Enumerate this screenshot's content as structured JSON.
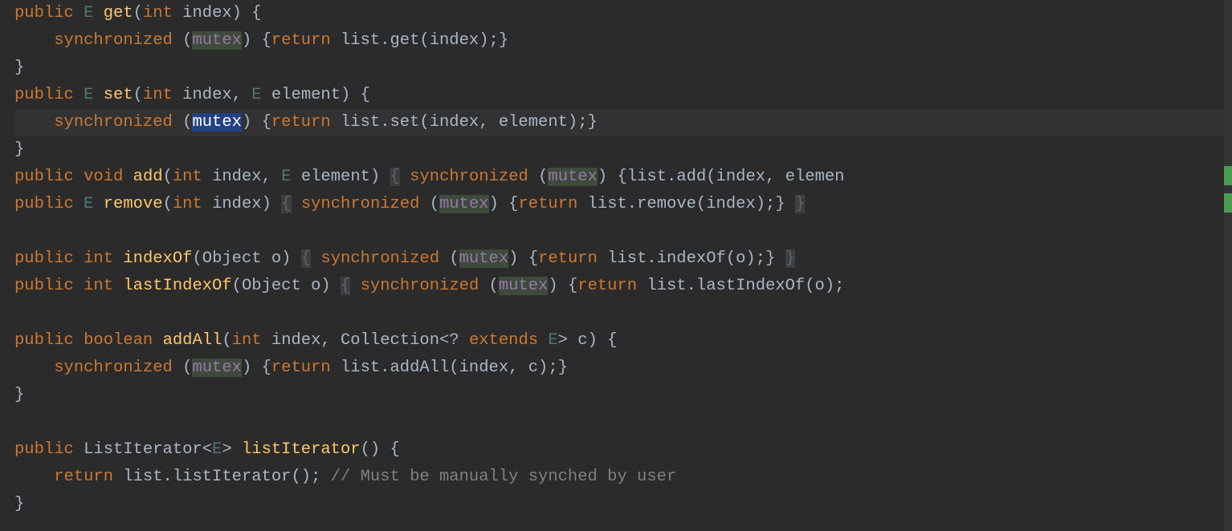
{
  "code": {
    "l1": {
      "kw1": "public",
      "type": "E",
      "method": "get",
      "sig1": "(",
      "kw2": "int",
      "sig2": " index) {"
    },
    "l2": {
      "kw": "synchronized",
      "p1": " (",
      "mut": "mutex",
      "p2": ") {",
      "ret": "return",
      "rest": " list.get(index);}"
    },
    "l3": {
      "br": "}"
    },
    "l4": {
      "kw1": "public",
      "type": "E",
      "method": "set",
      "sig1": "(",
      "kw2": "int",
      "sig2": " index, ",
      "type2": "E",
      "sig3": " element) {"
    },
    "l5": {
      "kw": "synchronized",
      "p1": " (",
      "mut": "mutex",
      "p2": ") {",
      "ret": "return",
      "rest": " list.set(index, element);}"
    },
    "l6": {
      "br": "}"
    },
    "l7": {
      "kw1": "public",
      "kw2": "void",
      "method": "add",
      "sig1": "(",
      "kw3": "int",
      "sig2": " index, ",
      "type": "E",
      "sig3": " element) ",
      "bh1": "{",
      "sp": " ",
      "kw4": "synchronized",
      "p1": " (",
      "mut": "mutex",
      "p2": ") {list.add(index, elemen"
    },
    "l8": {
      "kw1": "public",
      "type": "E",
      "method": "remove",
      "sig1": "(",
      "kw2": "int",
      "sig2": " index) ",
      "bh1": "{",
      "sp": " ",
      "kw3": "synchronized",
      "p1": " (",
      "mut": "mutex",
      "p2": ") {",
      "ret": "return",
      "rest": " list.remove(index);} ",
      "bh2": "}"
    },
    "l9": "",
    "l10": {
      "kw1": "public",
      "kw2": "int",
      "method": "indexOf",
      "sig1": "(Object o) ",
      "bh1": "{",
      "sp": " ",
      "kw3": "synchronized",
      "p1": " (",
      "mut": "mutex",
      "p2": ") {",
      "ret": "return",
      "rest": " list.indexOf(o);} ",
      "bh2": "}"
    },
    "l11": {
      "kw1": "public",
      "kw2": "int",
      "method": "lastIndexOf",
      "sig1": "(Object o) ",
      "bh1": "{",
      "sp": " ",
      "kw3": "synchronized",
      "p1": " (",
      "mut": "mutex",
      "p2": ") {",
      "ret": "return",
      "rest": " list.lastIndexOf(o);"
    },
    "l12": "",
    "l13": {
      "kw1": "public",
      "kw2": "boolean",
      "method": "addAll",
      "sig1": "(",
      "kw3": "int",
      "sig2": " index, Collection<? ",
      "kw4": "extends",
      "type": " E",
      "sig3": "> c) {"
    },
    "l14": {
      "kw": "synchronized",
      "p1": " (",
      "mut": "mutex",
      "p2": ") {",
      "ret": "return",
      "rest": " list.addAll(index, c);}"
    },
    "l15": {
      "br": "}"
    },
    "l16": "",
    "l17": {
      "kw1": "public",
      "type": " ListIterator<",
      "gen": "E",
      "type2": "> ",
      "method": "listIterator",
      "sig": "() {"
    },
    "l18": {
      "kw": "return",
      "rest": " list.listIterator(); ",
      "comment": "// Must be manually synched by user"
    },
    "l19": {
      "br": "}"
    }
  }
}
